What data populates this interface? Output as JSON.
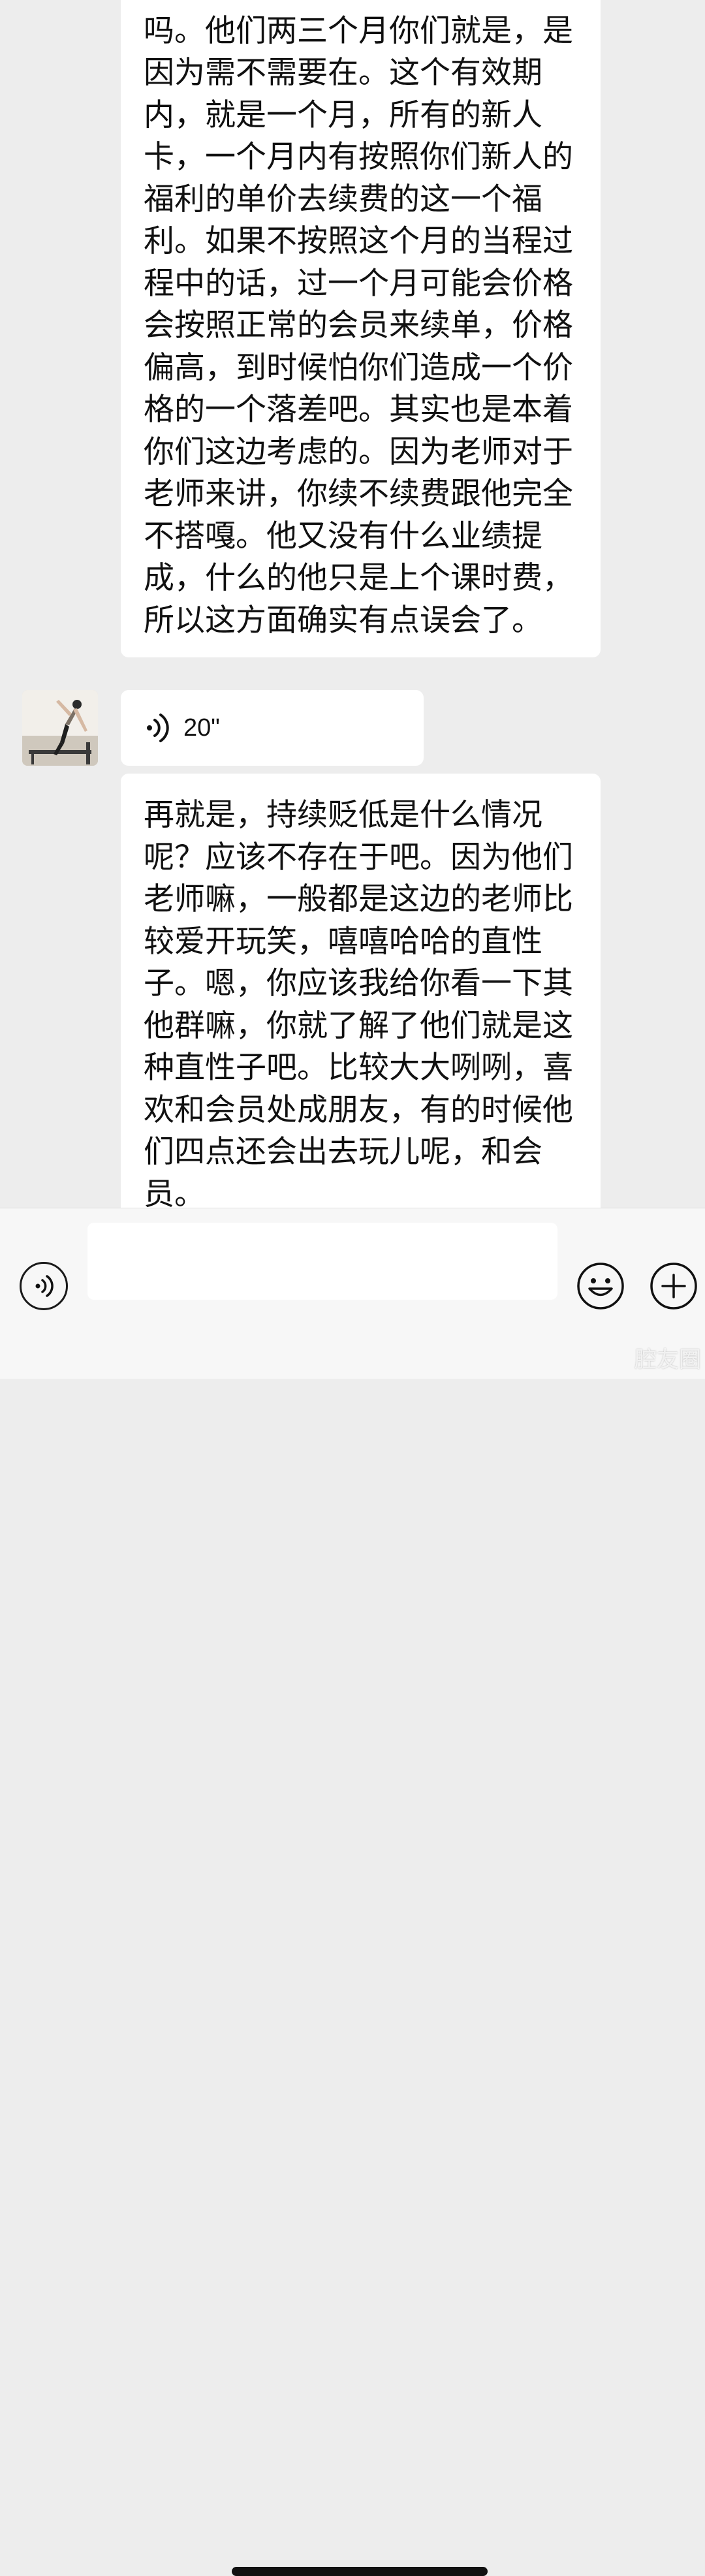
{
  "messages": [
    {
      "type": "text",
      "text": "吗。他们两三个月你们就是，是因为需不需要在。这个有效期内，就是一个月，所有的新人卡，一个月内有按照你们新人的福利的单价去续费的这一个福利。如果不按照这个月的当程过程中的话，过一个月可能会价格会按照正常的会员来续单，价格偏高，到时候怕你们造成一个价格的一个落差吧。其实也是本着你们这边考虑的。因为老师对于老师来讲，你续不续费跟他完全不搭嘎。他又没有什么业绩提成，什么的他只是上个课时费，所以这方面确实有点误会了。"
    },
    {
      "type": "voice",
      "duration": "20\""
    },
    {
      "type": "text",
      "text": "再就是，持续贬低是什么情况呢？应该不存在于吧。因为他们老师嘛，一般都是这边的老师比较爱开玩笑，嘻嘻哈哈的直性子。嗯，你应该我给你看一下其他群嘛，你就了解了他们就是这种直性子吧。比较大大咧咧，喜欢和会员处成朋友，有的时候他们四点还会出去玩儿呢，和会员。"
    }
  ],
  "input_bar": {
    "placeholder": "",
    "value": ""
  },
  "watermark": "腔友圈",
  "icons": {
    "voice_toggle": "voice-toggle-icon",
    "emoji": "smiley-icon",
    "plus": "plus-icon",
    "voice_message": "voice-wave-icon"
  },
  "colors": {
    "background": "#ededed",
    "bubble": "#ffffff",
    "text": "#111111",
    "input_bar": "#f7f7f7"
  }
}
